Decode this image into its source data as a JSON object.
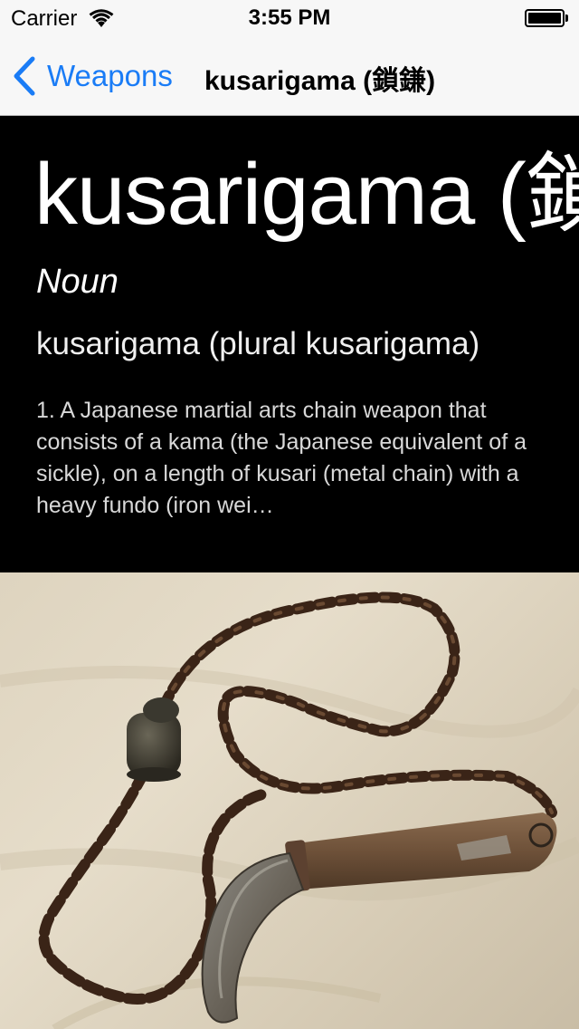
{
  "status_bar": {
    "carrier": "Carrier",
    "time": "3:55 PM"
  },
  "nav": {
    "back_label": "Weapons",
    "title": "kusarigama (鎖鎌)"
  },
  "entry": {
    "headword": "kusarigama (鎖鎌)",
    "part_of_speech": "Noun",
    "inflection": "kusarigama (plural kusarigama)",
    "sense": "1. A Japanese martial arts chain weapon that consists of a kama (the Japanese equivalent of a sickle), on a length of kusari (metal chain) with a heavy fundo (iron wei…"
  },
  "colors": {
    "accent": "#1a7cf6",
    "bar_background": "#f7f7f7",
    "content_background": "#000000"
  },
  "icons": {
    "back": "chevron-left-icon",
    "wifi": "wifi-icon",
    "battery": "battery-icon"
  }
}
